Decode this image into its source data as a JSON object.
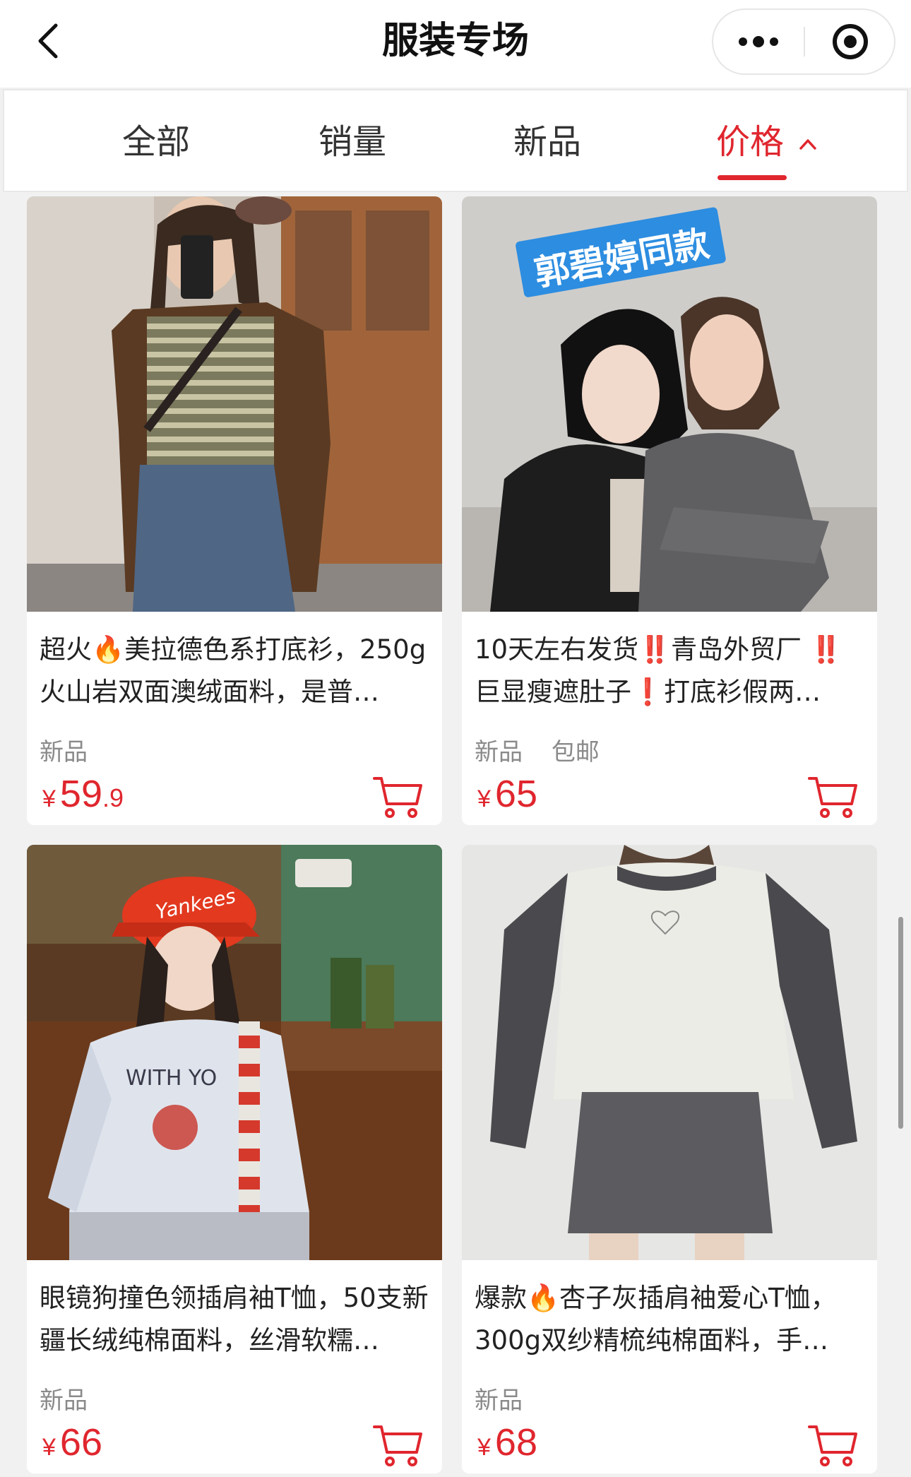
{
  "nav": {
    "title": "服装专场"
  },
  "tabs": [
    {
      "label": "全部"
    },
    {
      "label": "销量"
    },
    {
      "label": "新品"
    },
    {
      "label": "价格"
    }
  ],
  "active_tab": "价格",
  "sort_direction": "ascending",
  "accent_color": "#e0262e",
  "products": [
    {
      "title": "超火🔥美拉德色系打底衫，250g火山岩双面澳绒面料，是普…",
      "tags": [
        "新品"
      ],
      "currency": "¥",
      "price_int": "59",
      "price_dec": ".9"
    },
    {
      "image_caption": "郭碧婷同款",
      "title": "10天左右发货‼️青岛外贸厂 ‼️巨显瘦遮肚子❗打底衫假两…",
      "tags": [
        "新品",
        "包邮"
      ],
      "currency": "¥",
      "price_int": "65",
      "price_dec": ""
    },
    {
      "image_caption": "Yankees",
      "title": "眼镜狗撞色领插肩袖T恤，50支新疆长绒纯棉面料，丝滑软糯…",
      "tags": [
        "新品"
      ],
      "currency": "¥",
      "price_int": "66",
      "price_dec": ""
    },
    {
      "title": "爆款🔥杏子灰插肩袖爱心T恤，300g双纱精梳纯棉面料，手…",
      "tags": [
        "新品"
      ],
      "currency": "¥",
      "price_int": "68",
      "price_dec": ""
    }
  ]
}
